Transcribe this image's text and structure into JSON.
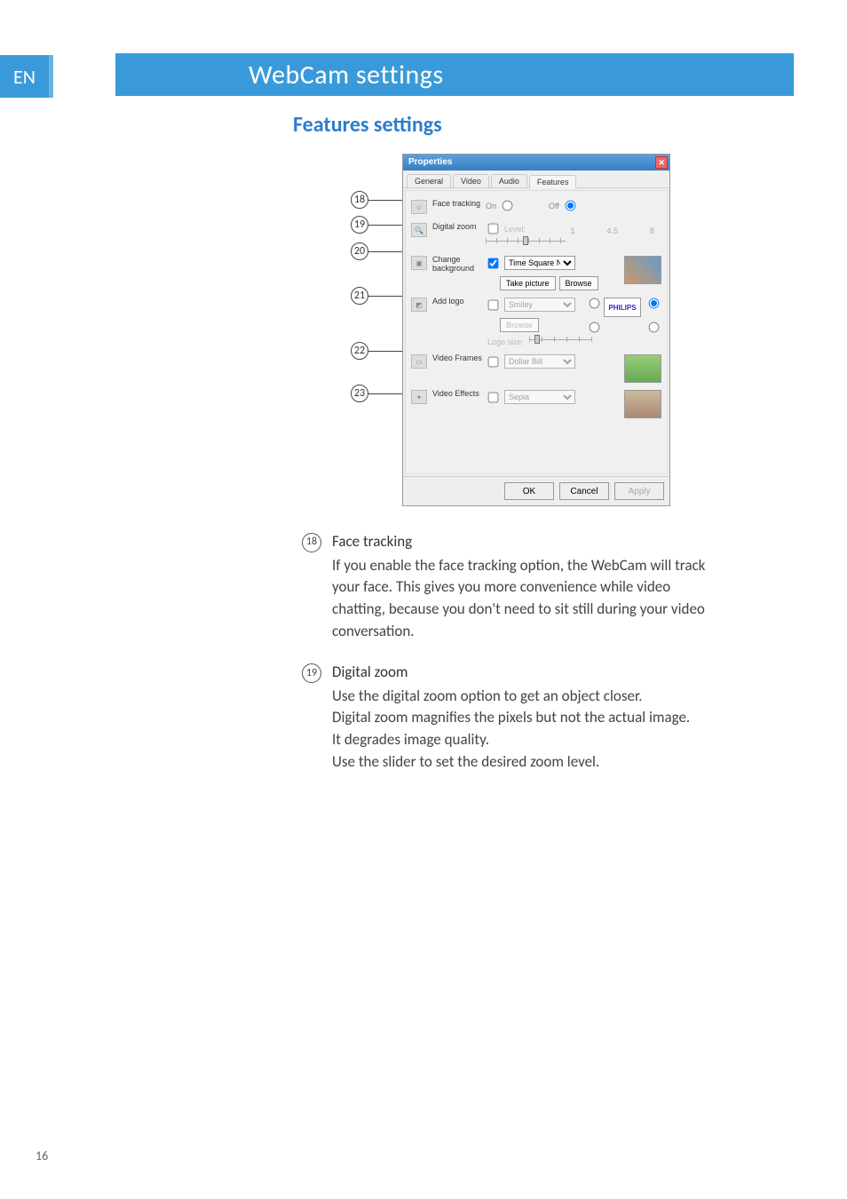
{
  "lang": "EN",
  "page_title": "WebCam settings",
  "section_title": "Features settings",
  "dialog": {
    "title": "Properties",
    "tabs": [
      "General",
      "Video",
      "Audio",
      "Features"
    ],
    "active_tab": 3,
    "rows": {
      "face_tracking": {
        "label": "Face tracking",
        "on": "On",
        "off": "Off"
      },
      "digital_zoom": {
        "label": "Digital zoom",
        "level": "Level:",
        "min": "1",
        "mid": "4.5",
        "max": "8"
      },
      "change_bg": {
        "label": "Change background",
        "select": "Time Square NY",
        "take": "Take picture",
        "browse": "Browse"
      },
      "add_logo": {
        "label": "Add logo",
        "select": "Smiley",
        "browse": "Browse",
        "size": "Logo size:",
        "brand": "PHILIPS"
      },
      "video_frames": {
        "label": "Video Frames",
        "select": "Dollar Bill"
      },
      "video_effects": {
        "label": "Video Effects",
        "select": "Sepia"
      }
    },
    "buttons": {
      "ok": "OK",
      "cancel": "Cancel",
      "apply": "Apply"
    }
  },
  "callouts": [
    "18",
    "19",
    "20",
    "21",
    "22",
    "23"
  ],
  "paragraphs": {
    "p18": {
      "num": "18",
      "head": "Face tracking",
      "body": "If you enable the face tracking option, the WebCam will track your face. This gives you more convenience while video chatting, because you don't need to sit still during your video conversation."
    },
    "p19": {
      "num": "19",
      "head": "Digital zoom",
      "l1": "Use the digital zoom option to get an object closer.",
      "l2": "Digital zoom magnifies the pixels but not the actual image.",
      "l3": "It degrades image quality.",
      "l4": "Use the slider to set the desired zoom level."
    }
  },
  "page_number": "16"
}
